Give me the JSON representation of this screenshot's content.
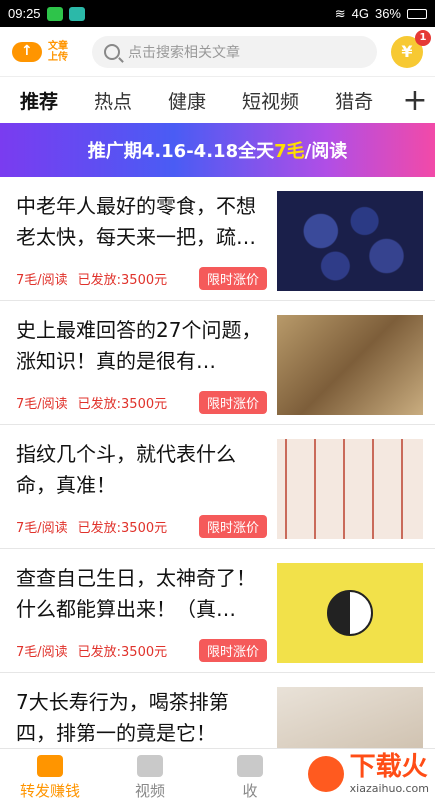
{
  "status_bar": {
    "time": "09:25",
    "signal": "4G",
    "battery": "36%"
  },
  "header": {
    "logo_text_line1": "文章",
    "logo_text_line2": "上传",
    "search_placeholder": "点击搜索相关文章",
    "coin_badge": "1",
    "coin_symbol": "¥"
  },
  "tabs": [
    "推荐",
    "热点",
    "健康",
    "短视频",
    "猎奇"
  ],
  "banner": {
    "prefix": "推广期4.16-4.18全天",
    "highlight": "7毛",
    "suffix": "/阅读"
  },
  "articles": [
    {
      "title": "中老年人最好的零食，不想老太快，每天来一把，疏…",
      "price": "7毛/阅读",
      "spent": "已发放:3500元",
      "tag": "限时涨价"
    },
    {
      "title": "史上最难回答的27个问题，涨知识！真的是很有…",
      "price": "7毛/阅读",
      "spent": "已发放:3500元",
      "tag": "限时涨价"
    },
    {
      "title": "指纹几个斗，就代表什么命，真准！",
      "price": "7毛/阅读",
      "spent": "已发放:3500元",
      "tag": "限时涨价"
    },
    {
      "title": "查查自己生日，太神奇了！什么都能算出来！（真…",
      "price": "7毛/阅读",
      "spent": "已发放:3500元",
      "tag": "限时涨价"
    },
    {
      "title": "7大长寿行为，喝茶排第四，排第一的竟是它！",
      "price": "",
      "spent": "",
      "tag": ""
    }
  ],
  "bottom_nav": [
    "转发赚钱",
    "视频",
    "收"
  ],
  "watermark": {
    "cn": "下载火",
    "en": "xiazaihuo.com"
  }
}
